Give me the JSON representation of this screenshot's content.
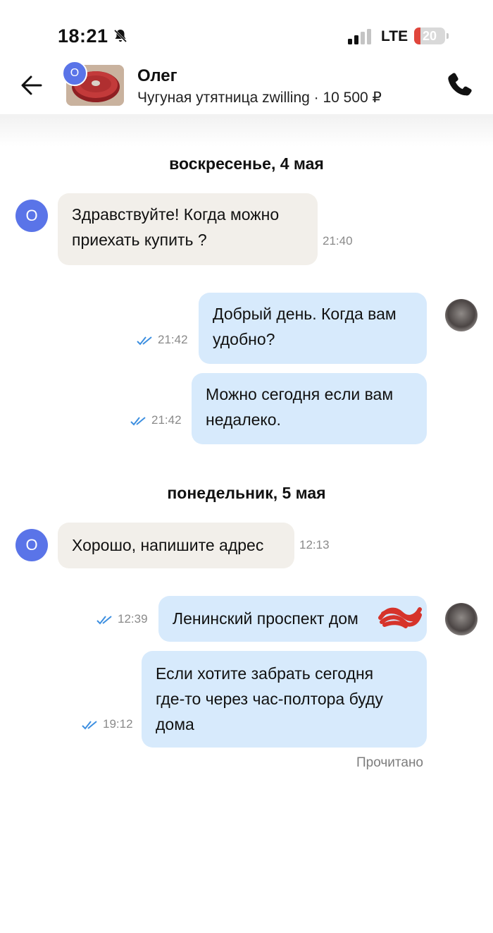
{
  "status_bar": {
    "time": "18:21",
    "network": "LTE",
    "battery": "20",
    "battery_level_percent": 20,
    "icons": [
      "bell-slash-icon",
      "signal-icon",
      "battery-icon"
    ]
  },
  "header": {
    "contact_name": "Олег",
    "contact_initial": "О",
    "product": "Чугуная утятница zwilling · 10 500 ₽",
    "icons": [
      "back-arrow-icon",
      "phone-icon"
    ]
  },
  "colors": {
    "accent": "#5a74e8",
    "incoming_bg": "#f2efea",
    "outgoing_bg": "#d7eafc",
    "battery_low": "#e0463c",
    "tick": "#3d8fe0"
  },
  "dates": [
    "воскресенье, 4 мая",
    "понедельник, 5 мая"
  ],
  "messages": [
    {
      "from": "other",
      "lines": [
        "Здравствуйте! Когда можно",
        "приехать купить ?"
      ],
      "time": "21:40"
    },
    {
      "from": "me",
      "lines": [
        "Добрый день. Когда вам",
        "удобно?"
      ],
      "time": "21:42"
    },
    {
      "from": "me",
      "lines": [
        "Можно сегодня если вам",
        "недалеко."
      ],
      "time": "21:42"
    },
    {
      "from": "other",
      "lines": [
        "Хорошо, напишите адрес"
      ],
      "time": "12:13"
    },
    {
      "from": "me",
      "lines": [
        "Ленинский проспект дом"
      ],
      "time": "12:39"
    },
    {
      "from": "me",
      "lines": [
        "Если хотите забрать сегодня",
        "где-то через час-полтора буду",
        "дома"
      ],
      "time": "19:12"
    }
  ],
  "read_status": "Прочитано"
}
